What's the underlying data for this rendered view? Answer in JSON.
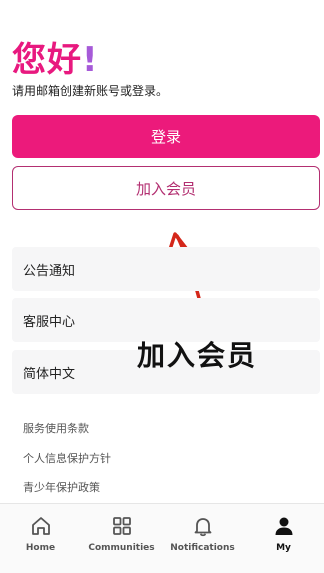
{
  "header": {
    "greeting": "您好",
    "exclamation": "!",
    "subtitle": "请用邮箱创建新账号或登录。"
  },
  "buttons": {
    "login": "登录",
    "join": "加入会员"
  },
  "menu": [
    "公告通知",
    "客服中心",
    "简体中文"
  ],
  "annotation": "加入会员",
  "links": [
    "服务使用条款",
    "个人信息保护方针",
    "青少年保护政策"
  ],
  "tabs": [
    "Home",
    "Communities",
    "Notifications",
    "My"
  ],
  "colors": {
    "accent": "#ec1a7b",
    "join_border": "#b32f71",
    "arrow": "#d4271a"
  }
}
